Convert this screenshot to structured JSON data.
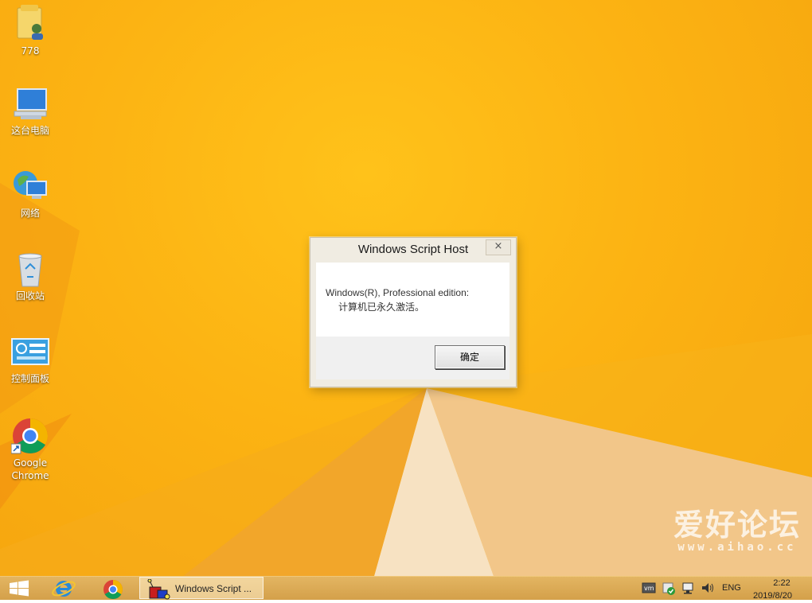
{
  "desktop": {
    "icons": [
      {
        "label": "778"
      },
      {
        "label": "这台电脑"
      },
      {
        "label": "网络"
      },
      {
        "label": "回收站"
      },
      {
        "label": "控制面板"
      },
      {
        "label": "Google Chrome"
      }
    ]
  },
  "dialog": {
    "title": "Windows Script Host",
    "close_glyph": "×",
    "line1": "Windows(R), Professional edition:",
    "line2": "计算机已永久激活。",
    "ok_label": "确定"
  },
  "watermark": {
    "text": "爱好论坛",
    "url": "www.aihao.cc"
  },
  "taskbar": {
    "task_label": "Windows Script ...",
    "language": "ENG",
    "time": "2:22",
    "date": "2019/8/20"
  },
  "colors": {
    "wallpaper": "#fcb313",
    "taskbar": "#d9a650",
    "dialog_frame": "#f0ece2"
  }
}
